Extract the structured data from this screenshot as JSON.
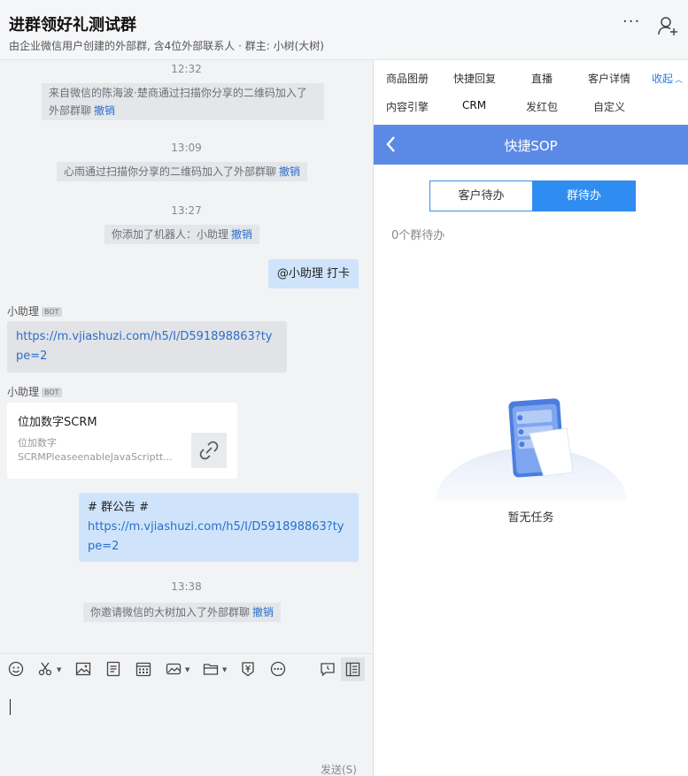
{
  "header": {
    "title": "进群领好礼测试群",
    "subtitle": "由企业微信用户创建的外部群, 含4位外部联系人 · 群主: 小树(大树)",
    "more_label": "···"
  },
  "chat": {
    "messages": [
      {
        "time": "12:32",
        "text": "来自微信的陈海波·楚商通过扫描你分享的二维码加入了外部群聊",
        "undo": "撤销"
      },
      {
        "time": "13:09",
        "text": "心雨通过扫描你分享的二维码加入了外部群聊",
        "undo": "撤销"
      },
      {
        "time": "13:27",
        "text": "你添加了机器人：小助理",
        "undo": "撤销"
      }
    ],
    "my_message": "@小助理 打卡",
    "bot_name": "小助理",
    "bot_tag": "BOT",
    "bot_link": "https://m.vjiashuzi.com/h5/I/D591898863?type=2",
    "card": {
      "title": "位加数字SCRM",
      "desc_line1": "位加数字",
      "desc_line2": "SCRMPleaseenableJavaScriptt..."
    },
    "notice_title": "# 群公告 #",
    "notice_link": "https://m.vjiashuzi.com/h5/I/D591898863?type=2",
    "last_time": "13:38",
    "last_text": "你邀请微信的大树加入了外部群聊",
    "last_undo": "撤销"
  },
  "toolbar": {
    "icons": [
      "emoji-icon",
      "scissors-icon",
      "image-icon",
      "document-icon",
      "calendar-icon",
      "picture-icon",
      "folder-icon",
      "money-icon",
      "more-icon",
      "chat-history-icon",
      "panel-icon"
    ]
  },
  "input": {
    "send_label": "发送(S)"
  },
  "right_panel": {
    "tabs_row1": [
      "商品图册",
      "快捷回复",
      "直播",
      "客户详情"
    ],
    "collapse_label": "收起",
    "tabs_row2": [
      "内容引擎",
      "CRM",
      "发红包",
      "自定义"
    ],
    "sop_title": "快捷SOP",
    "segment_left": "客户待办",
    "segment_right": "群待办",
    "count_text": "0个群待办",
    "empty_text": "暂无任务"
  },
  "colors": {
    "accent": "#2f8cf0",
    "sop_bar": "#5b8ae6",
    "link": "#2a6ecb",
    "my_bubble": "#cfe4fb"
  }
}
